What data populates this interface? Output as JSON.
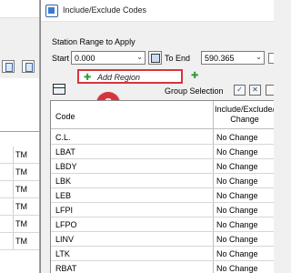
{
  "background_window": {
    "cells": [
      "TM",
      "TM",
      "TM",
      "TM",
      "TM",
      "TM"
    ]
  },
  "dialog": {
    "title": "Include/Exclude Codes",
    "station_range_label": "Station Range to Apply",
    "start_label": "Start",
    "start_value": "0.000",
    "to_end_label": "To End",
    "end_value": "590.365",
    "add_region_label": "Add Region",
    "step_number": "2",
    "group_selection_label": "Group Selection",
    "table": {
      "headers": {
        "code": "Code",
        "change_line1": "Include/Exclude/",
        "change_line2": "Change"
      },
      "rows": [
        {
          "code": "C.L.",
          "change": "No Change"
        },
        {
          "code": "LBAT",
          "change": "No Change"
        },
        {
          "code": "LBDY",
          "change": "No Change"
        },
        {
          "code": "LBK",
          "change": "No Change"
        },
        {
          "code": "LEB",
          "change": "No Change"
        },
        {
          "code": "LFPI",
          "change": "No Change"
        },
        {
          "code": "LFPO",
          "change": "No Change"
        },
        {
          "code": "LINV",
          "change": "No Change"
        },
        {
          "code": "LTK",
          "change": "No Change"
        },
        {
          "code": "RBAT",
          "change": "No Change"
        }
      ]
    }
  },
  "icons": {
    "app": "app-icon",
    "pick": "pick-station-icon",
    "add": "plus-icon",
    "table": "table-options-icon",
    "check_all": "check-all-icon",
    "uncheck_all": "uncheck-all-icon"
  },
  "colors": {
    "highlight": "#d9343b",
    "plus": "#2e9a3a",
    "dialog_bg": "#f0f0f0"
  }
}
